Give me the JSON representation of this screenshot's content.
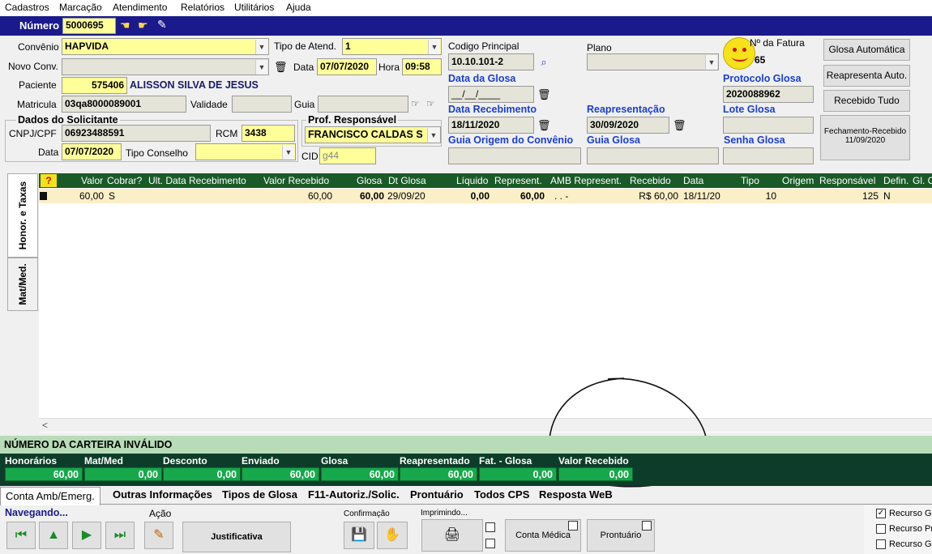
{
  "menu": [
    "Cadastros",
    "Marcação",
    "Atendimento",
    "Relatórios",
    "Utilitários",
    "Ajuda"
  ],
  "header": {
    "numero_label": "Número",
    "numero_value": "5000695"
  },
  "form": {
    "convenio_label": "Convênio",
    "convenio_value": "HAPVIDA",
    "tipo_atend_label": "Tipo de Atend.",
    "tipo_atend_value": "1",
    "novo_conv_label": "Novo Conv.",
    "data_label": "Data",
    "data_value": "07/07/2020",
    "hora_label": "Hora",
    "hora_value": "09:58",
    "paciente_label": "Paciente",
    "paciente_id": "575406",
    "paciente_nome": "ALISSON SILVA DE JESUS",
    "matricula_label": "Matricula",
    "matricula_value": "03qa8000089001",
    "validade_label": "Validade",
    "guia_label": "Guia",
    "solicitante_title": "Dados do Solicitante",
    "cnpj_label": "CNPJ/CPF",
    "cnpj_value": "06923488591",
    "rcm_label": "RCM",
    "rcm_value": "3438",
    "data2_label": "Data",
    "data2_value": "07/07/2020",
    "tipo_conselho_label": "Tipo Conselho",
    "prof_title": "Prof. Responsável",
    "prof_value": "FRANCISCO CALDAS S",
    "cid_label": "CID",
    "cid_value": "g44",
    "codigo_label": "Codigo Principal",
    "codigo_value": "10.10.101-2",
    "plano_label": "Plano",
    "fatura_label": "Nº da Fatura",
    "fatura_value": "65",
    "data_glosa_label": "Data da Glosa",
    "data_glosa_value": "__/__/____",
    "protocolo_label": "Protocolo Glosa",
    "protocolo_value": "2020088962",
    "data_receb_label": "Data Recebimento",
    "data_receb_value": "18/11/2020",
    "reapres_label": "Reapresentação",
    "reapres_value": "30/09/2020",
    "lote_label": "Lote Glosa",
    "guia_origem_label": "Guia Origem do Convênio",
    "guia_glosa_label": "Guia Glosa",
    "senha_label": "Senha Glosa"
  },
  "buttons": {
    "glosa_auto": "Glosa Automática",
    "reapresenta": "Reapresenta Auto.",
    "recebido_tudo": "Recebido Tudo",
    "fechamento_l1": "Fechamento-Recebido",
    "fechamento_l2": "11/09/2020"
  },
  "vtabs": [
    "Honor. e Taxas",
    "Mat/Med."
  ],
  "grid": {
    "columns": [
      "Valor",
      "Cobrar?",
      "Ult. Data Recebimento",
      "Valor Recebido",
      "Glosa",
      "Dt Glosa",
      "Líquido",
      "Represent.",
      "AMB Represent.",
      "Recebido",
      "Data",
      "Tipo",
      "Origem",
      "Responsável",
      "Defin.",
      "Gl. C"
    ],
    "rows": [
      [
        "60,00",
        "S",
        "",
        "60,00",
        "60,00",
        "29/09/20",
        "0,00",
        "60,00",
        ". .  -",
        "R$ 60,00",
        "18/11/20",
        "10",
        "",
        "125",
        "N",
        ""
      ]
    ]
  },
  "warning": "NÚMERO DA CARTEIRA INVÁLIDO",
  "totals": [
    {
      "label": "Honorários",
      "value": "60,00"
    },
    {
      "label": "Mat/Med",
      "value": "0,00"
    },
    {
      "label": "Desconto",
      "value": "0,00"
    },
    {
      "label": "Enviado",
      "value": "60,00"
    },
    {
      "label": "Glosa",
      "value": "60,00"
    },
    {
      "label": "Reapresentado",
      "value": "60,00"
    },
    {
      "label": "Fat. - Glosa",
      "value": "0,00"
    },
    {
      "label": "Valor Recebido",
      "value": "0,00"
    }
  ],
  "bottom_tabs": [
    "Conta Amb/Emerg.",
    "Outras Informações",
    "Tipos de Glosa",
    "F11-Autoriz./Solic.",
    "Prontuário",
    "Todos CPS",
    "Resposta WeB"
  ],
  "footer": {
    "navegando": "Navegando...",
    "acao": "Ação",
    "justificativa": "Justificativa",
    "confirmacao": "Confirmação",
    "imprimindo": "Imprimindo...",
    "conta_medica": "Conta Médica",
    "prontuario": "Prontuário",
    "recursos": [
      "Recurso G",
      "Recurso Pr",
      "Recurso G"
    ]
  }
}
